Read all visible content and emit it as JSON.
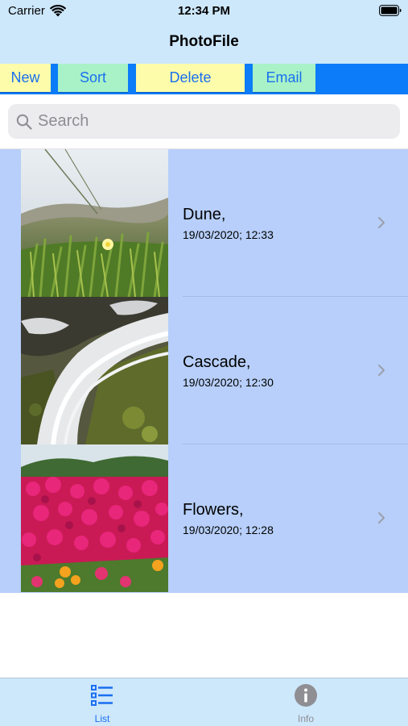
{
  "status_bar": {
    "carrier": "Carrier",
    "time": "12:34 PM"
  },
  "nav": {
    "title": "PhotoFile"
  },
  "toolbar": {
    "new_label": "New",
    "sort_label": "Sort",
    "delete_label": "Delete",
    "email_label": "Email"
  },
  "search": {
    "placeholder": "Search",
    "value": ""
  },
  "list": {
    "items": [
      {
        "title": "Dune,",
        "subtitle": "19/03/2020; 12:33",
        "thumbnail": "dune-photo"
      },
      {
        "title": "Cascade,",
        "subtitle": "19/03/2020; 12:30",
        "thumbnail": "cascade-photo"
      },
      {
        "title": "Flowers,",
        "subtitle": "19/03/2020; 12:28",
        "thumbnail": "flowers-photo"
      }
    ]
  },
  "tabbar": {
    "tabs": [
      {
        "label": "List",
        "icon": "list-icon",
        "selected": true
      },
      {
        "label": "Info",
        "icon": "info-icon",
        "selected": false
      }
    ]
  },
  "colors": {
    "bar_background": "#cde7fb",
    "toolbar_background": "#0d7cf8",
    "button_yellow": "#fcfcaa",
    "button_green": "#a9f2c7",
    "list_background": "#b7cffa",
    "accent": "#1a6ff0"
  }
}
